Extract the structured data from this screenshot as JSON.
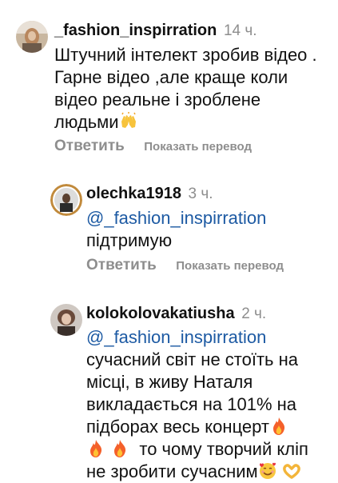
{
  "comments": [
    {
      "username": "_fashion_inspirration",
      "time": "14 ч.",
      "text": "Штучний інтелект зробив відео . Гарне відео ,але краще коли відео реальне і зроблене людьми",
      "emoji_trailing": "raising-hands",
      "reply_label": "Ответить",
      "translate_label": "Показать перевод"
    },
    {
      "username": "olechka1918",
      "time": "3 ч.",
      "mention": "@_fashion_inspirration",
      "text": "підтримую",
      "reply_label": "Ответить",
      "translate_label": "Показать перевод"
    },
    {
      "username": "kolokolovakatiusha",
      "time": "2 ч.",
      "mention": "@_fashion_inspirration",
      "text_line1": "сучасний світ не стоїть на",
      "text_line2": "місці, в живу Наталя",
      "text_line3": "викладається на 101% на",
      "text_line4": "підборах весь концерт",
      "text_line5": "то чому творчий кліп",
      "text_line6": "не зробити сучасним",
      "emojis": [
        "fire-icon",
        "fire-icon",
        "fire-icon",
        "smiling-face-with-hearts",
        "heart-hands"
      ]
    }
  ],
  "colors": {
    "mention": "#1d5aa3",
    "muted": "#8e8e8e",
    "text": "#111111"
  }
}
